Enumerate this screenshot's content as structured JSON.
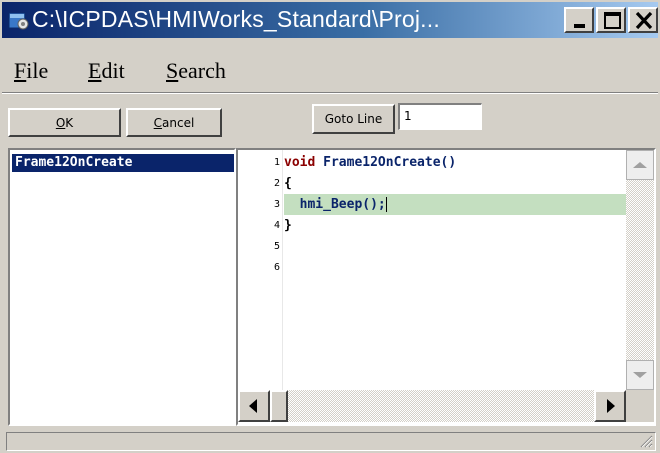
{
  "window": {
    "title": "C:\\ICPDAS\\HMIWorks_Standard\\Proj...",
    "app_icon": "app-icon",
    "caption_buttons": [
      "minimize-icon",
      "maximize-icon",
      "close-icon"
    ]
  },
  "menu": {
    "file_first": "F",
    "file_rest": "ile",
    "edit_first": "E",
    "edit_rest": "dit",
    "search_first": "S",
    "search_rest": "earch"
  },
  "toolbar": {
    "ok_first": "O",
    "ok_rest": "K",
    "cancel_first": "C",
    "cancel_rest": "ancel",
    "goto_label": "Goto Line",
    "goto_value": "1"
  },
  "functions": {
    "items": [
      "Frame12OnCreate"
    ],
    "selected": "Frame12OnCreate"
  },
  "editor": {
    "line_numbers": [
      "1",
      "2",
      "3",
      "4",
      "5",
      "6"
    ],
    "lines": {
      "l1_kw": "void",
      "l1_rest": " Frame12OnCreate()",
      "l2": "{",
      "l3": "  hmi_Beep();",
      "l4": "}"
    },
    "highlight_line": 3,
    "highlight_color": "#c4dfc0",
    "keyword_color": "#8b0000"
  },
  "scrollbars": {
    "icons": [
      "scroll-up-arrow-icon",
      "scroll-down-arrow-icon",
      "scroll-left-arrow-icon",
      "scroll-right-arrow-icon"
    ]
  },
  "colors": {
    "title_gradient_start": "#0a246a",
    "title_gradient_end": "#a6caf0",
    "face": "#d4d0c8",
    "selection": "#0a246a"
  }
}
